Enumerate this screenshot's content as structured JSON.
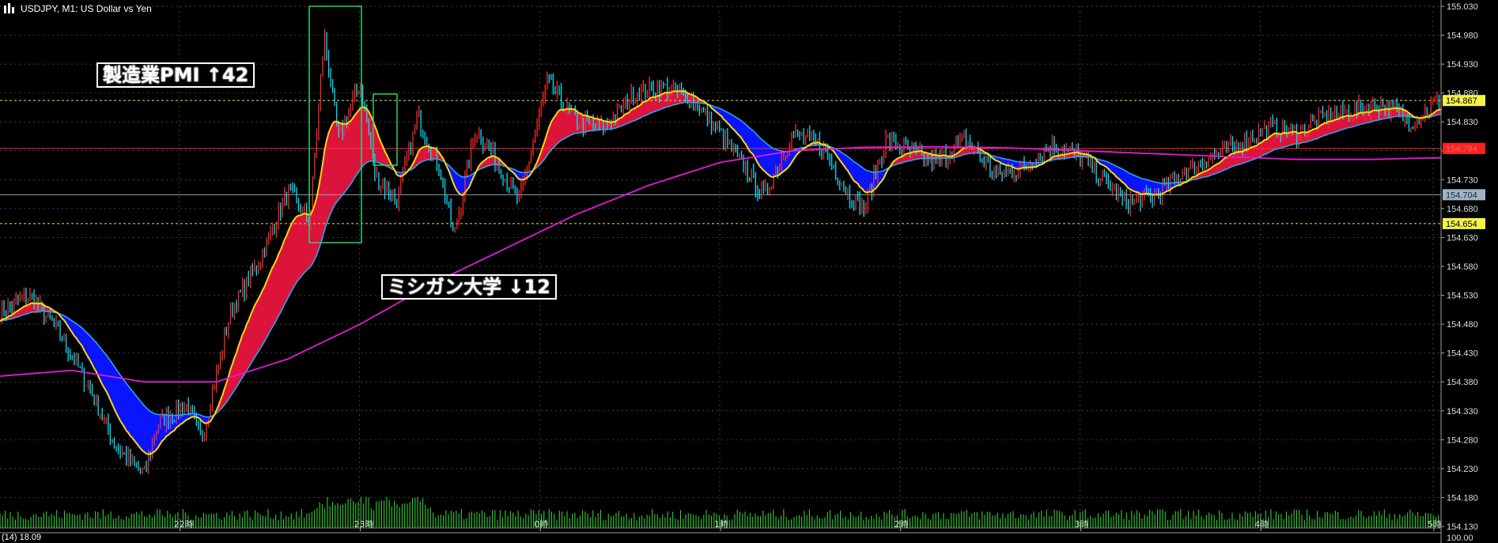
{
  "header": {
    "symbol_label": "USDJPY, M1:  US Dollar vs Yen"
  },
  "annotations": [
    {
      "text": "製造業PMI ↑42"
    },
    {
      "text": "ミシガン大学 ↓12"
    }
  ],
  "footer": {
    "indicator_label": "(14) 18.09"
  },
  "price_scale": {
    "right_label_100": "100.00"
  },
  "colors": {
    "background": "#000000",
    "grid": "#5a5a5a",
    "candle_up": "#ff2a2a",
    "candle_down": "#00e5ff",
    "fast_ma": "#ffd700",
    "slow_ma": "#29a3e8",
    "long_ma": "#e619d6",
    "cloud_bull": "#dc143c",
    "cloud_bear": "#0a14ff",
    "volume": "#32cd32",
    "box": "#2fcf6a",
    "level_yellow": "#e8e84a",
    "level_red": "#ff3030",
    "level_grey": "#8fa3b3"
  },
  "chart_data": {
    "type": "candlestick",
    "title": "USDJPY, M1:  US Dollar vs Yen",
    "ylim": [
      154.13,
      155.03
    ],
    "y_ticks": [
      "155.030",
      "154.980",
      "154.930",
      "154.880",
      "154.830",
      "154.780",
      "154.730",
      "154.680",
      "154.630",
      "154.580",
      "154.530",
      "154.480",
      "154.430",
      "154.380",
      "154.330",
      "154.280",
      "154.230",
      "154.180",
      "154.130"
    ],
    "x_tick_labels": [
      "22時",
      "23時",
      "0時",
      "1時",
      "2時",
      "3時",
      "4時",
      "5時"
    ],
    "price_markers": [
      {
        "value": "154.867",
        "kind": "yellow"
      },
      {
        "value": "154.784",
        "kind": "red"
      },
      {
        "value": "154.704",
        "kind": "grey"
      },
      {
        "value": "154.654",
        "kind": "yellow"
      }
    ],
    "price_path": [
      [
        0,
        154.5
      ],
      [
        0.02,
        154.53
      ],
      [
        0.04,
        154.47
      ],
      [
        0.06,
        154.38
      ],
      [
        0.08,
        154.27
      ],
      [
        0.1,
        154.22
      ],
      [
        0.11,
        154.31
      ],
      [
        0.13,
        154.34
      ],
      [
        0.14,
        154.28
      ],
      [
        0.16,
        154.5
      ],
      [
        0.18,
        154.59
      ],
      [
        0.2,
        154.71
      ],
      [
        0.215,
        154.66
      ],
      [
        0.225,
        154.98
      ],
      [
        0.235,
        154.8
      ],
      [
        0.25,
        154.9
      ],
      [
        0.26,
        154.74
      ],
      [
        0.275,
        154.69
      ],
      [
        0.29,
        154.84
      ],
      [
        0.305,
        154.75
      ],
      [
        0.315,
        154.63
      ],
      [
        0.33,
        154.82
      ],
      [
        0.345,
        154.76
      ],
      [
        0.36,
        154.69
      ],
      [
        0.38,
        154.9
      ],
      [
        0.4,
        154.83
      ],
      [
        0.42,
        154.82
      ],
      [
        0.44,
        154.88
      ],
      [
        0.46,
        154.89
      ],
      [
        0.48,
        154.87
      ],
      [
        0.5,
        154.81
      ],
      [
        0.52,
        154.74
      ],
      [
        0.53,
        154.7
      ],
      [
        0.55,
        154.81
      ],
      [
        0.57,
        154.79
      ],
      [
        0.59,
        154.7
      ],
      [
        0.6,
        154.68
      ],
      [
        0.615,
        154.8
      ],
      [
        0.63,
        154.78
      ],
      [
        0.65,
        154.76
      ],
      [
        0.67,
        154.8
      ],
      [
        0.69,
        154.74
      ],
      [
        0.71,
        154.75
      ],
      [
        0.73,
        154.79
      ],
      [
        0.75,
        154.77
      ],
      [
        0.77,
        154.72
      ],
      [
        0.78,
        154.69
      ],
      [
        0.8,
        154.7
      ],
      [
        0.82,
        154.74
      ],
      [
        0.84,
        154.77
      ],
      [
        0.86,
        154.79
      ],
      [
        0.88,
        154.82
      ],
      [
        0.9,
        154.81
      ],
      [
        0.92,
        154.84
      ],
      [
        0.94,
        154.85
      ],
      [
        0.96,
        154.86
      ],
      [
        0.98,
        154.83
      ],
      [
        1.0,
        154.87
      ]
    ],
    "long_ma_path": [
      [
        0,
        154.39
      ],
      [
        0.05,
        154.4
      ],
      [
        0.1,
        154.38
      ],
      [
        0.15,
        154.38
      ],
      [
        0.2,
        154.42
      ],
      [
        0.25,
        154.48
      ],
      [
        0.3,
        154.55
      ],
      [
        0.35,
        154.61
      ],
      [
        0.4,
        154.67
      ],
      [
        0.45,
        154.72
      ],
      [
        0.5,
        154.76
      ],
      [
        0.55,
        154.78
      ],
      [
        0.6,
        154.786
      ],
      [
        0.65,
        154.787
      ],
      [
        0.7,
        154.785
      ],
      [
        0.75,
        154.78
      ],
      [
        0.8,
        154.775
      ],
      [
        0.85,
        154.77
      ],
      [
        0.9,
        154.765
      ],
      [
        0.95,
        154.765
      ],
      [
        1.0,
        154.768
      ]
    ],
    "volume": {
      "axis_max": 100,
      "label": "(14) 18.09"
    }
  }
}
